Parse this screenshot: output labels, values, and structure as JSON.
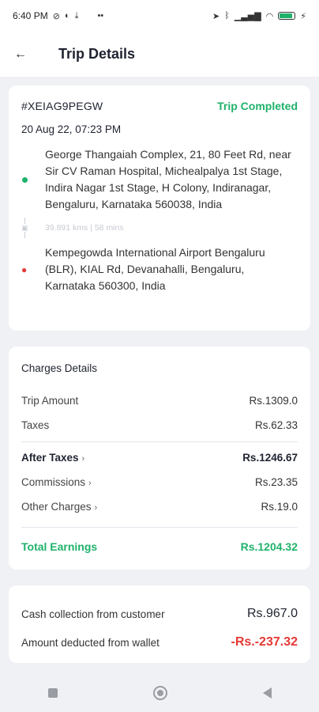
{
  "status_bar": {
    "time": "6:40 PM",
    "left_icons": [
      "wifi-off-icon",
      "data-icon",
      "download-icon"
    ],
    "more": "••",
    "right_icons": [
      "location-icon",
      "bluetooth-icon",
      "signal-icon",
      "wifi-icon",
      "battery-icon",
      "charging-icon"
    ],
    "battery_level": 0.85
  },
  "header": {
    "title": "Trip Details"
  },
  "trip": {
    "id": "#XEIAG9PEGW",
    "status": "Trip Completed",
    "date": "20 Aug 22, 07:23 PM",
    "pickup": "George Thangaiah Complex, 21, 80 Feet Rd, near Sir CV Raman Hospital, Michealpalya 1st Stage, Indira Nagar 1st Stage, H Colony, Indiranagar, Bengaluru, Karnataka 560038, India",
    "distance_time": "39.891 kms | 58 mins",
    "drop": "Kempegowda International Airport Bengaluru (BLR), KIAL Rd, Devanahalli, Bengaluru, Karnataka 560300, India"
  },
  "charges": {
    "title": "Charges Details",
    "trip_amount": {
      "label": "Trip Amount",
      "value": "Rs.1309.0"
    },
    "taxes": {
      "label": "Taxes",
      "value": "Rs.62.33"
    },
    "after_taxes": {
      "label": "After Taxes",
      "value": "Rs.1246.67"
    },
    "commissions": {
      "label": "Commissions",
      "value": "Rs.23.35"
    },
    "other_charges": {
      "label": "Other Charges",
      "value": "Rs.19.0"
    },
    "total_earnings": {
      "label": "Total Earnings",
      "value": "Rs.1204.32"
    }
  },
  "cash": {
    "collection": {
      "label": "Cash collection from customer",
      "value": "Rs.967.0"
    },
    "deducted": {
      "label": "Amount deducted from wallet",
      "value": "-Rs.-237.32"
    }
  },
  "colors": {
    "accent_green": "#1fb26b",
    "negative_red": "#e53935"
  }
}
